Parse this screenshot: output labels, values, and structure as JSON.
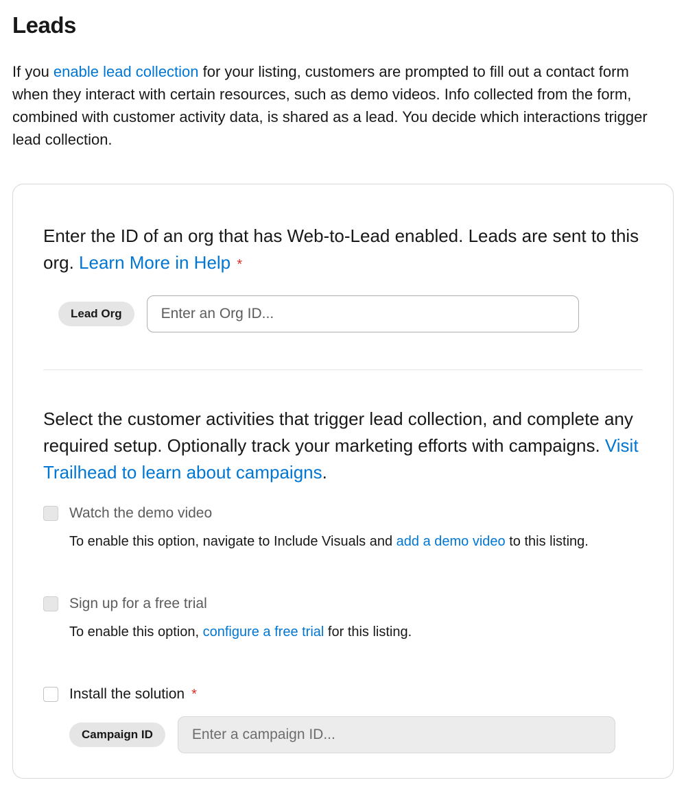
{
  "page": {
    "title": "Leads"
  },
  "intro": {
    "prefix": "If you ",
    "link": "enable lead collection",
    "suffix": " for your listing, customers are prompted to fill out a contact form when they interact with certain resources, such as demo videos. Info collected from the form, combined with customer activity data, is shared as a lead. You decide which interactions trigger lead collection."
  },
  "section1": {
    "heading_prefix": "Enter the ID of an org that has Web-to-Lead enabled. Leads are sent to this org. ",
    "heading_link": "Learn More in Help",
    "required_marker": "*",
    "pill_label": "Lead Org",
    "input_placeholder": "Enter an Org ID..."
  },
  "section2": {
    "heading_prefix": "Select the customer activities that trigger lead collection, and complete any required setup. Optionally track your marketing efforts with campaigns. ",
    "heading_link": "Visit Trailhead to learn about campaigns",
    "heading_suffix": ".",
    "options": [
      {
        "label": "Watch the demo video",
        "help_prefix": "To enable this option, navigate to Include Visuals and ",
        "help_link": "add a demo video",
        "help_suffix": " to this listing."
      },
      {
        "label": "Sign up for a free trial",
        "help_prefix": "To enable this option, ",
        "help_link": "configure a free trial",
        "help_suffix": " for this listing."
      },
      {
        "label": "Install the solution",
        "required_marker": "*",
        "campaign_pill": "Campaign ID",
        "campaign_placeholder": "Enter a campaign ID..."
      }
    ]
  }
}
